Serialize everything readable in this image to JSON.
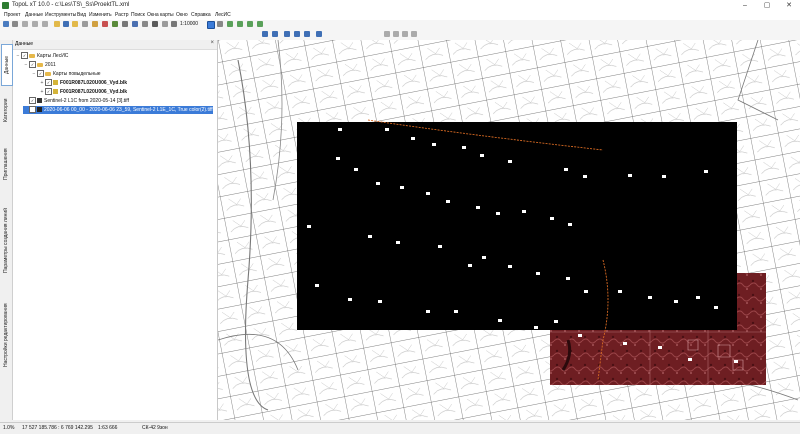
{
  "window": {
    "title": "TopoL xT 10.0 - c:\\Les\\TS\\_Ss\\ProektTL.xml",
    "controls": [
      "–",
      "▢",
      "✕"
    ]
  },
  "menu": [
    "Проект",
    "Данные",
    "Инструменты",
    "Вид",
    "Изменить",
    "Растр",
    "Поиск",
    "Окна карты",
    "Окно",
    "Справка",
    "ЛесИС"
  ],
  "toolbar": {
    "scale": "1:10000"
  },
  "side_tabs": [
    "Данные",
    "Категории",
    "Приглашения",
    "Параметры создания линий",
    "Настройки редактирования"
  ],
  "panel": {
    "title": "Данные",
    "close": "×",
    "tree": [
      {
        "label": "Карты ЛесИС",
        "level": 0,
        "expand": "−"
      },
      {
        "label": "2011",
        "level": 1,
        "expand": "−"
      },
      {
        "label": "Карты повыдельные",
        "level": 2,
        "expand": "−"
      },
      {
        "label": "F001R087L020U006_Vyd.blk",
        "level": 3,
        "expand": "+"
      },
      {
        "label": "F001R087L020U006_Vyd.blk",
        "level": 3,
        "expand": "+"
      },
      {
        "label": "Sentinel-2 L1C from 2020-05-14 [3].tiff",
        "level": 0,
        "expand": ""
      },
      {
        "label": "2020-06-06 00_00 - 2020-06-06 23_59, Sentinel-2 L1E_1C, True color(2).tiff",
        "level": 0,
        "expand": "",
        "selected": true
      }
    ]
  },
  "status": {
    "zoom": "1.0%",
    "coords": "17 527 185.786 : 6 769 142.295",
    "scale": "1:63 666",
    "crs": "СК-42 9зон"
  }
}
